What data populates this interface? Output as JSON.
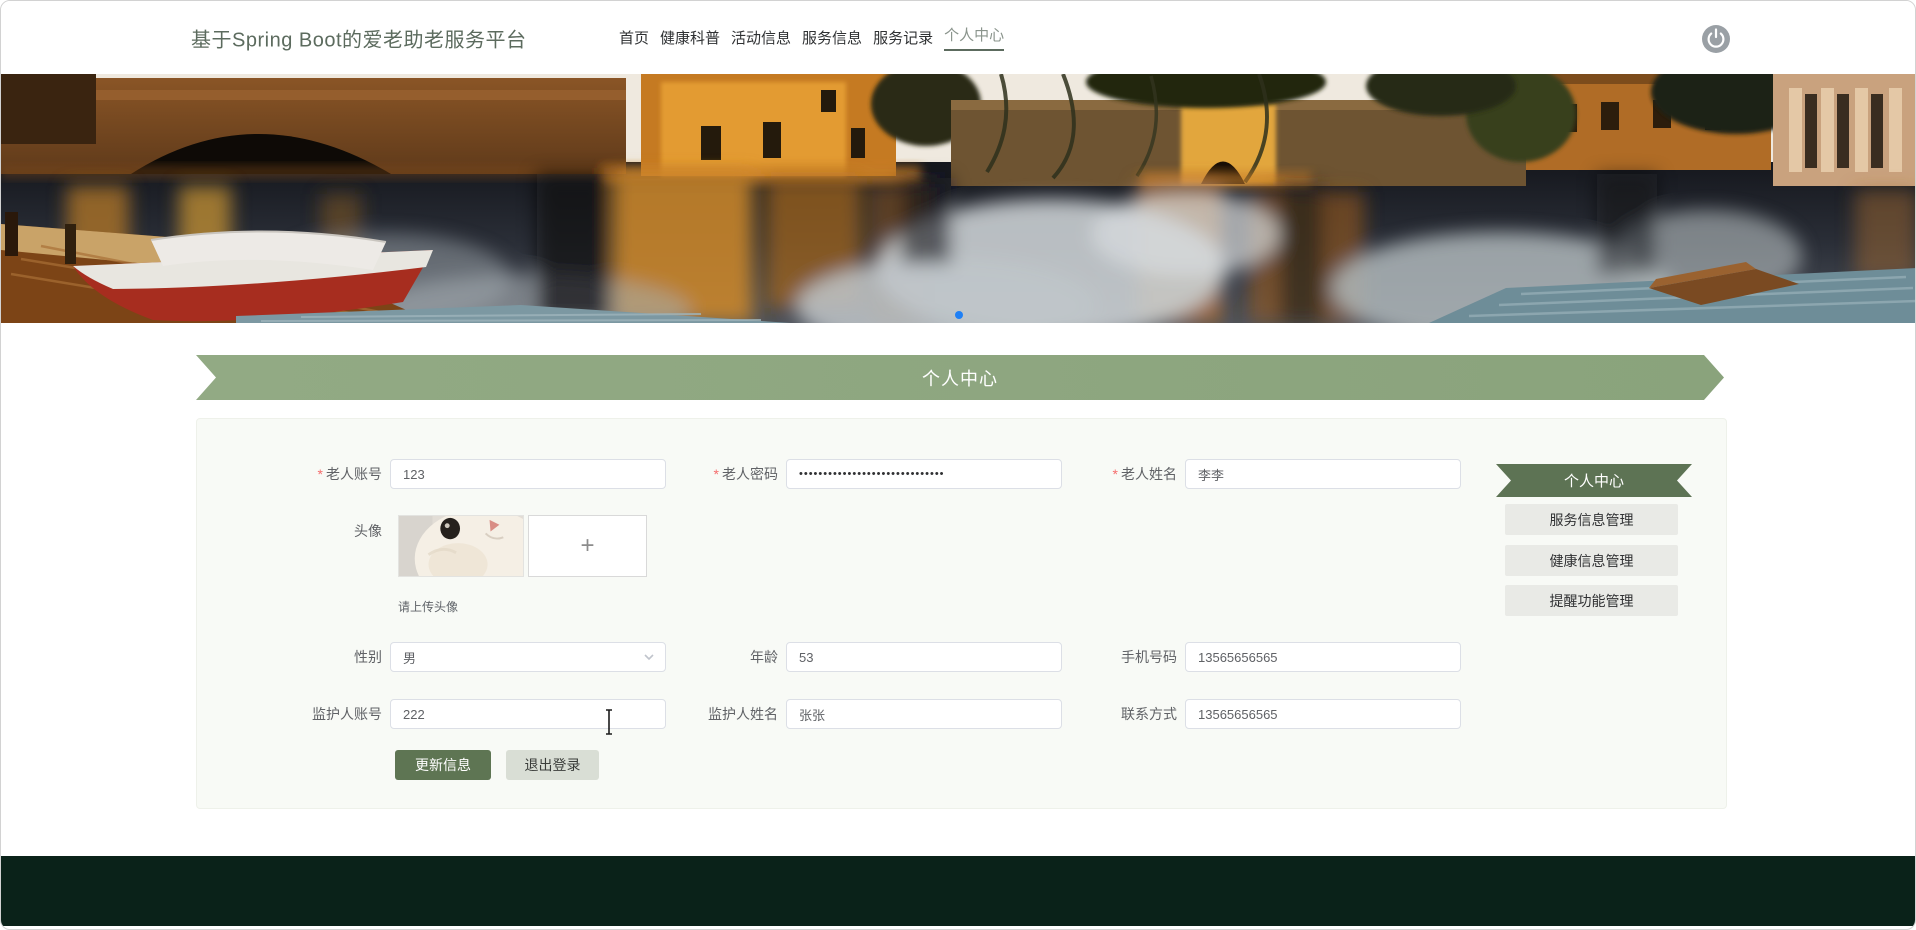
{
  "header": {
    "title": "基于Spring Boot的爱老助老服务平台",
    "nav": [
      {
        "label": "首页"
      },
      {
        "label": "健康科普"
      },
      {
        "label": "活动信息"
      },
      {
        "label": "服务信息"
      },
      {
        "label": "服务记录"
      },
      {
        "label": "个人中心",
        "active": true
      }
    ]
  },
  "section": {
    "title": "个人中心"
  },
  "form": {
    "account": {
      "label": "老人账号",
      "required": "*",
      "value": "123"
    },
    "password": {
      "label": "老人密码",
      "required": "*",
      "value": "••••••••••••••••••••••••••••••"
    },
    "name": {
      "label": "老人姓名",
      "required": "*",
      "value": "李李"
    },
    "avatar": {
      "label": "头像",
      "hint": "请上传头像",
      "plus": "+"
    },
    "gender": {
      "label": "性别",
      "value": "男"
    },
    "age": {
      "label": "年龄",
      "value": "53"
    },
    "phone": {
      "label": "手机号码",
      "value": "13565656565"
    },
    "guardian_account": {
      "label": "监护人账号",
      "value": "222"
    },
    "guardian_name": {
      "label": "监护人姓名",
      "value": "张张"
    },
    "contact": {
      "label": "联系方式",
      "value": "13565656565"
    },
    "buttons": {
      "update": "更新信息",
      "logout": "退出登录"
    }
  },
  "sidebar": {
    "items": [
      {
        "label": "个人中心",
        "active": true
      },
      {
        "label": "服务信息管理"
      },
      {
        "label": "健康信息管理"
      },
      {
        "label": "提醒功能管理"
      }
    ]
  },
  "colors": {
    "accent_green": "#5d7354",
    "ribbon_green": "#8fa881",
    "footer_green": "#0a2219",
    "required_red": "#f56c6c",
    "carousel_dot_blue": "#1f80f5"
  }
}
